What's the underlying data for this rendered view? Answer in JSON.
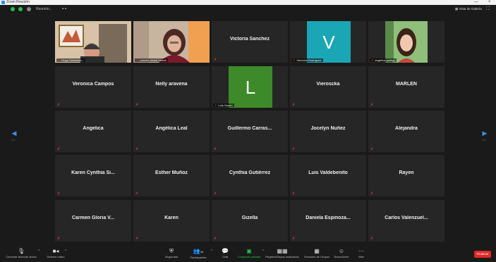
{
  "window": {
    "title": "Zoom Reunión",
    "controls": [
      "—",
      "×"
    ]
  },
  "topbar": {
    "meeting_info": "Reunión...",
    "view_label": "Vista de Galería",
    "colors": {
      "green": "#2dbd4a",
      "gray": "#8a8a8a"
    }
  },
  "grid": {
    "page_left": "1/2",
    "page_right": "1/2",
    "tiles": [
      {
        "type": "video",
        "label": "Hugo Sebastian..."
      },
      {
        "type": "video",
        "label": "pamela mirasi bernal"
      },
      {
        "type": "name",
        "name": "Victoria Sanchez"
      },
      {
        "type": "letter",
        "letter": "V",
        "color": "#1ba6b6",
        "label": "Verónica Rodríguez"
      },
      {
        "type": "video",
        "label": "angelica gallego"
      },
      {
        "type": "name",
        "name": "Veronica Campos"
      },
      {
        "type": "name",
        "name": "Nelly aravena"
      },
      {
        "type": "letter",
        "letter": "L",
        "color": "#3e8a2a",
        "label": "Luis Osorio"
      },
      {
        "type": "name",
        "name": "Vieroscka"
      },
      {
        "type": "name",
        "name": "MARLEN"
      },
      {
        "type": "name",
        "name": "Angelica"
      },
      {
        "type": "name",
        "name": "Angélica Leal"
      },
      {
        "type": "name",
        "name": "Guillermo  Carras..."
      },
      {
        "type": "name",
        "name": "Jocelyn Nuñez"
      },
      {
        "type": "name",
        "name": "Alejandra"
      },
      {
        "type": "name",
        "name": "Karen Cynthia Si..."
      },
      {
        "type": "name",
        "name": "Esther Muñoz"
      },
      {
        "type": "name",
        "name": "Cynthia Gutiérrez"
      },
      {
        "type": "name",
        "name": "Luis Valdebenito"
      },
      {
        "type": "name",
        "name": "Rayen"
      },
      {
        "type": "name",
        "name": "Carmen Gloria V..."
      },
      {
        "type": "name",
        "name": "Karen"
      },
      {
        "type": "name",
        "name": "Gizella"
      },
      {
        "type": "name",
        "name": "Daniela  Espinoza..."
      },
      {
        "type": "name",
        "name": "Carlos  Valenzuel..."
      }
    ]
  },
  "toolbar": {
    "audio": "Cancelar silenciar ahora",
    "video": "Detener video",
    "security": "Seguridad",
    "participants": "Participantes",
    "participants_count": "26",
    "chat": "Chat",
    "share": "Compartir pantalla",
    "record": "Registro/Rayos analizados",
    "rooms": "Sesiones de Grupos",
    "reactions": "Reacciones",
    "more": "Más",
    "end": "Finalizar"
  },
  "icons": {
    "audio": "microphone-icon",
    "video": "video-camera-icon",
    "security": "shield-icon",
    "participants": "people-icon",
    "chat": "chat-bubble-icon",
    "share": "share-screen-icon",
    "record": "record-icon",
    "rooms": "breakout-rooms-icon",
    "reactions": "smiley-icon",
    "more": "ellipsis-icon"
  }
}
